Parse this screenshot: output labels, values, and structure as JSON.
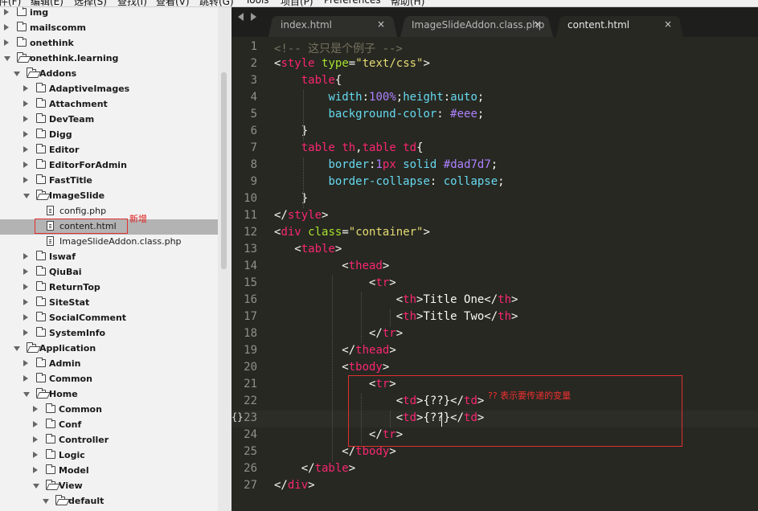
{
  "menubar": {
    "items": [
      "件(F)",
      "编辑(E)",
      "选择(S)",
      "查找(I)",
      "查看(V)",
      "跳转(G)",
      "Tools",
      "项目(P)",
      "Preferences",
      "帮助(H)"
    ]
  },
  "sidebar": {
    "items": [
      {
        "label": "img",
        "type": "folder",
        "state": "closed",
        "depth": 0
      },
      {
        "label": "mailscomm",
        "type": "folder",
        "state": "closed",
        "depth": 0
      },
      {
        "label": "onethink",
        "type": "folder",
        "state": "closed",
        "depth": 0
      },
      {
        "label": "onethink.learning",
        "type": "folder",
        "state": "open",
        "depth": 0
      },
      {
        "label": "Addons",
        "type": "folder",
        "state": "open",
        "depth": 1
      },
      {
        "label": "AdaptiveImages",
        "type": "folder",
        "state": "closed",
        "depth": 2
      },
      {
        "label": "Attachment",
        "type": "folder",
        "state": "closed",
        "depth": 2
      },
      {
        "label": "DevTeam",
        "type": "folder",
        "state": "closed",
        "depth": 2
      },
      {
        "label": "Digg",
        "type": "folder",
        "state": "closed",
        "depth": 2
      },
      {
        "label": "Editor",
        "type": "folder",
        "state": "closed",
        "depth": 2
      },
      {
        "label": "EditorForAdmin",
        "type": "folder",
        "state": "closed",
        "depth": 2
      },
      {
        "label": "FastTitle",
        "type": "folder",
        "state": "closed",
        "depth": 2
      },
      {
        "label": "ImageSlide",
        "type": "folder",
        "state": "open",
        "depth": 2
      },
      {
        "label": "config.php",
        "type": "file",
        "depth": 3
      },
      {
        "label": "content.html",
        "type": "file",
        "depth": 3,
        "selected": true
      },
      {
        "label": "ImageSlideAddon.class.php",
        "type": "file",
        "depth": 3
      },
      {
        "label": "Iswaf",
        "type": "folder",
        "state": "closed",
        "depth": 2
      },
      {
        "label": "QiuBai",
        "type": "folder",
        "state": "closed",
        "depth": 2
      },
      {
        "label": "ReturnTop",
        "type": "folder",
        "state": "closed",
        "depth": 2
      },
      {
        "label": "SiteStat",
        "type": "folder",
        "state": "closed",
        "depth": 2
      },
      {
        "label": "SocialComment",
        "type": "folder",
        "state": "closed",
        "depth": 2
      },
      {
        "label": "SystemInfo",
        "type": "folder",
        "state": "closed",
        "depth": 2
      },
      {
        "label": "Application",
        "type": "folder",
        "state": "open",
        "depth": 1
      },
      {
        "label": "Admin",
        "type": "folder",
        "state": "closed",
        "depth": 2
      },
      {
        "label": "Common",
        "type": "folder",
        "state": "closed",
        "depth": 2
      },
      {
        "label": "Home",
        "type": "folder",
        "state": "open",
        "depth": 2
      },
      {
        "label": "Common",
        "type": "folder",
        "state": "closed",
        "depth": 3
      },
      {
        "label": "Conf",
        "type": "folder",
        "state": "closed",
        "depth": 3
      },
      {
        "label": "Controller",
        "type": "folder",
        "state": "closed",
        "depth": 3
      },
      {
        "label": "Logic",
        "type": "folder",
        "state": "closed",
        "depth": 3
      },
      {
        "label": "Model",
        "type": "folder",
        "state": "closed",
        "depth": 3
      },
      {
        "label": "View",
        "type": "folder",
        "state": "open",
        "depth": 3
      },
      {
        "label": "default",
        "type": "folder",
        "state": "open",
        "depth": 4
      }
    ],
    "annotation_new": "新增"
  },
  "tabs": [
    {
      "label": "index.html",
      "active": false,
      "close": "×"
    },
    {
      "label": "ImageSlideAddon.class.php",
      "active": false,
      "close": "×"
    },
    {
      "label": "content.html",
      "active": true,
      "close": "×"
    }
  ],
  "gutter_marker": "{}",
  "code_annotation": "?? 表示要传递的变量",
  "code": [
    {
      "n": "1",
      "tokens": [
        [
          "com",
          "<!-- 这只是个例子 -->"
        ]
      ]
    },
    {
      "n": "2",
      "tokens": [
        [
          "txt",
          "<"
        ],
        [
          "tag",
          "style"
        ],
        [
          "txt",
          " "
        ],
        [
          "attr",
          "type"
        ],
        [
          "txt",
          "="
        ],
        [
          "str",
          "\"text/css\""
        ],
        [
          "txt",
          ">"
        ]
      ]
    },
    {
      "n": "3",
      "tokens": [
        [
          "txt",
          "    "
        ],
        [
          "tag",
          "table"
        ],
        [
          "txt",
          "{"
        ]
      ]
    },
    {
      "n": "4",
      "tokens": [
        [
          "txt",
          "        "
        ],
        [
          "kw",
          "width"
        ],
        [
          "txt",
          ":"
        ],
        [
          "num",
          "100%"
        ],
        [
          "txt",
          ";"
        ],
        [
          "kw",
          "height"
        ],
        [
          "txt",
          ":"
        ],
        [
          "kw",
          "auto"
        ],
        [
          "txt",
          ";"
        ]
      ]
    },
    {
      "n": "5",
      "tokens": [
        [
          "txt",
          "        "
        ],
        [
          "kw",
          "background-color"
        ],
        [
          "txt",
          ": "
        ],
        [
          "num",
          "#eee"
        ],
        [
          "txt",
          ";"
        ]
      ]
    },
    {
      "n": "6",
      "tokens": [
        [
          "txt",
          "    }"
        ]
      ]
    },
    {
      "n": "7",
      "tokens": [
        [
          "txt",
          "    "
        ],
        [
          "tag",
          "table"
        ],
        [
          "txt",
          " "
        ],
        [
          "tag",
          "th"
        ],
        [
          "txt",
          ","
        ],
        [
          "tag",
          "table"
        ],
        [
          "txt",
          " "
        ],
        [
          "tag",
          "td"
        ],
        [
          "txt",
          "{"
        ]
      ]
    },
    {
      "n": "8",
      "tokens": [
        [
          "txt",
          "        "
        ],
        [
          "kw",
          "border"
        ],
        [
          "txt",
          ":"
        ],
        [
          "num",
          "1"
        ],
        [
          "tag",
          "px"
        ],
        [
          "txt",
          " "
        ],
        [
          "kw",
          "solid"
        ],
        [
          "txt",
          " "
        ],
        [
          "num",
          "#dad7d7"
        ],
        [
          "txt",
          ";"
        ]
      ]
    },
    {
      "n": "9",
      "tokens": [
        [
          "txt",
          "        "
        ],
        [
          "kw",
          "border-collapse"
        ],
        [
          "txt",
          ": "
        ],
        [
          "kw",
          "collapse"
        ],
        [
          "txt",
          ";"
        ]
      ]
    },
    {
      "n": "10",
      "tokens": [
        [
          "txt",
          "    }"
        ]
      ]
    },
    {
      "n": "11",
      "tokens": [
        [
          "txt",
          "</"
        ],
        [
          "tag",
          "style"
        ],
        [
          "txt",
          ">"
        ]
      ]
    },
    {
      "n": "12",
      "tokens": [
        [
          "txt",
          "<"
        ],
        [
          "tag",
          "div"
        ],
        [
          "txt",
          " "
        ],
        [
          "attr",
          "class"
        ],
        [
          "txt",
          "="
        ],
        [
          "str",
          "\"container\""
        ],
        [
          "txt",
          ">"
        ]
      ]
    },
    {
      "n": "13",
      "tokens": [
        [
          "txt",
          "   <"
        ],
        [
          "tag",
          "table"
        ],
        [
          "txt",
          ">"
        ]
      ]
    },
    {
      "n": "14",
      "tokens": [
        [
          "txt",
          "          <"
        ],
        [
          "tag",
          "thead"
        ],
        [
          "txt",
          ">"
        ]
      ]
    },
    {
      "n": "15",
      "tokens": [
        [
          "txt",
          "              <"
        ],
        [
          "tag",
          "tr"
        ],
        [
          "txt",
          ">"
        ]
      ]
    },
    {
      "n": "16",
      "tokens": [
        [
          "txt",
          "                  <"
        ],
        [
          "tag",
          "th"
        ],
        [
          "txt",
          ">Title One</"
        ],
        [
          "tag",
          "th"
        ],
        [
          "txt",
          ">"
        ]
      ]
    },
    {
      "n": "17",
      "tokens": [
        [
          "txt",
          "                  <"
        ],
        [
          "tag",
          "th"
        ],
        [
          "txt",
          ">Title Two</"
        ],
        [
          "tag",
          "th"
        ],
        [
          "txt",
          ">"
        ]
      ]
    },
    {
      "n": "18",
      "tokens": [
        [
          "txt",
          "              </"
        ],
        [
          "tag",
          "tr"
        ],
        [
          "txt",
          ">"
        ]
      ]
    },
    {
      "n": "19",
      "tokens": [
        [
          "txt",
          "          </"
        ],
        [
          "tag",
          "thead"
        ],
        [
          "txt",
          ">"
        ]
      ]
    },
    {
      "n": "20",
      "tokens": [
        [
          "txt",
          "          <"
        ],
        [
          "tag",
          "tbody"
        ],
        [
          "txt",
          ">"
        ]
      ]
    },
    {
      "n": "21",
      "tokens": [
        [
          "txt",
          "              <"
        ],
        [
          "tag",
          "tr"
        ],
        [
          "txt",
          ">"
        ]
      ]
    },
    {
      "n": "22",
      "tokens": [
        [
          "txt",
          "                  <"
        ],
        [
          "tag",
          "td"
        ],
        [
          "txt",
          ">{??}</"
        ],
        [
          "tag",
          "td"
        ],
        [
          "txt",
          ">"
        ]
      ]
    },
    {
      "n": "23",
      "tokens": [
        [
          "txt",
          "                  <"
        ],
        [
          "tag",
          "td"
        ],
        [
          "txt",
          ">{??}</"
        ],
        [
          "tag",
          "td"
        ],
        [
          "txt",
          ">"
        ]
      ]
    },
    {
      "n": "24",
      "tokens": [
        [
          "txt",
          "              </"
        ],
        [
          "tag",
          "tr"
        ],
        [
          "txt",
          ">"
        ]
      ]
    },
    {
      "n": "25",
      "tokens": [
        [
          "txt",
          "          </"
        ],
        [
          "tag",
          "tbody"
        ],
        [
          "txt",
          ">"
        ]
      ]
    },
    {
      "n": "26",
      "tokens": [
        [
          "txt",
          "    </"
        ],
        [
          "tag",
          "table"
        ],
        [
          "txt",
          ">"
        ]
      ]
    },
    {
      "n": "27",
      "tokens": [
        [
          "txt",
          "</"
        ],
        [
          "tag",
          "div"
        ],
        [
          "txt",
          ">"
        ]
      ]
    }
  ],
  "colors": {
    "editor_bg": "#272822",
    "tag": "#f92672",
    "attr": "#a6e22e",
    "string": "#e6db74",
    "number": "#ae81ff",
    "keyword": "#66d9ef",
    "comment": "#75715e",
    "annotation": "#e03030"
  }
}
